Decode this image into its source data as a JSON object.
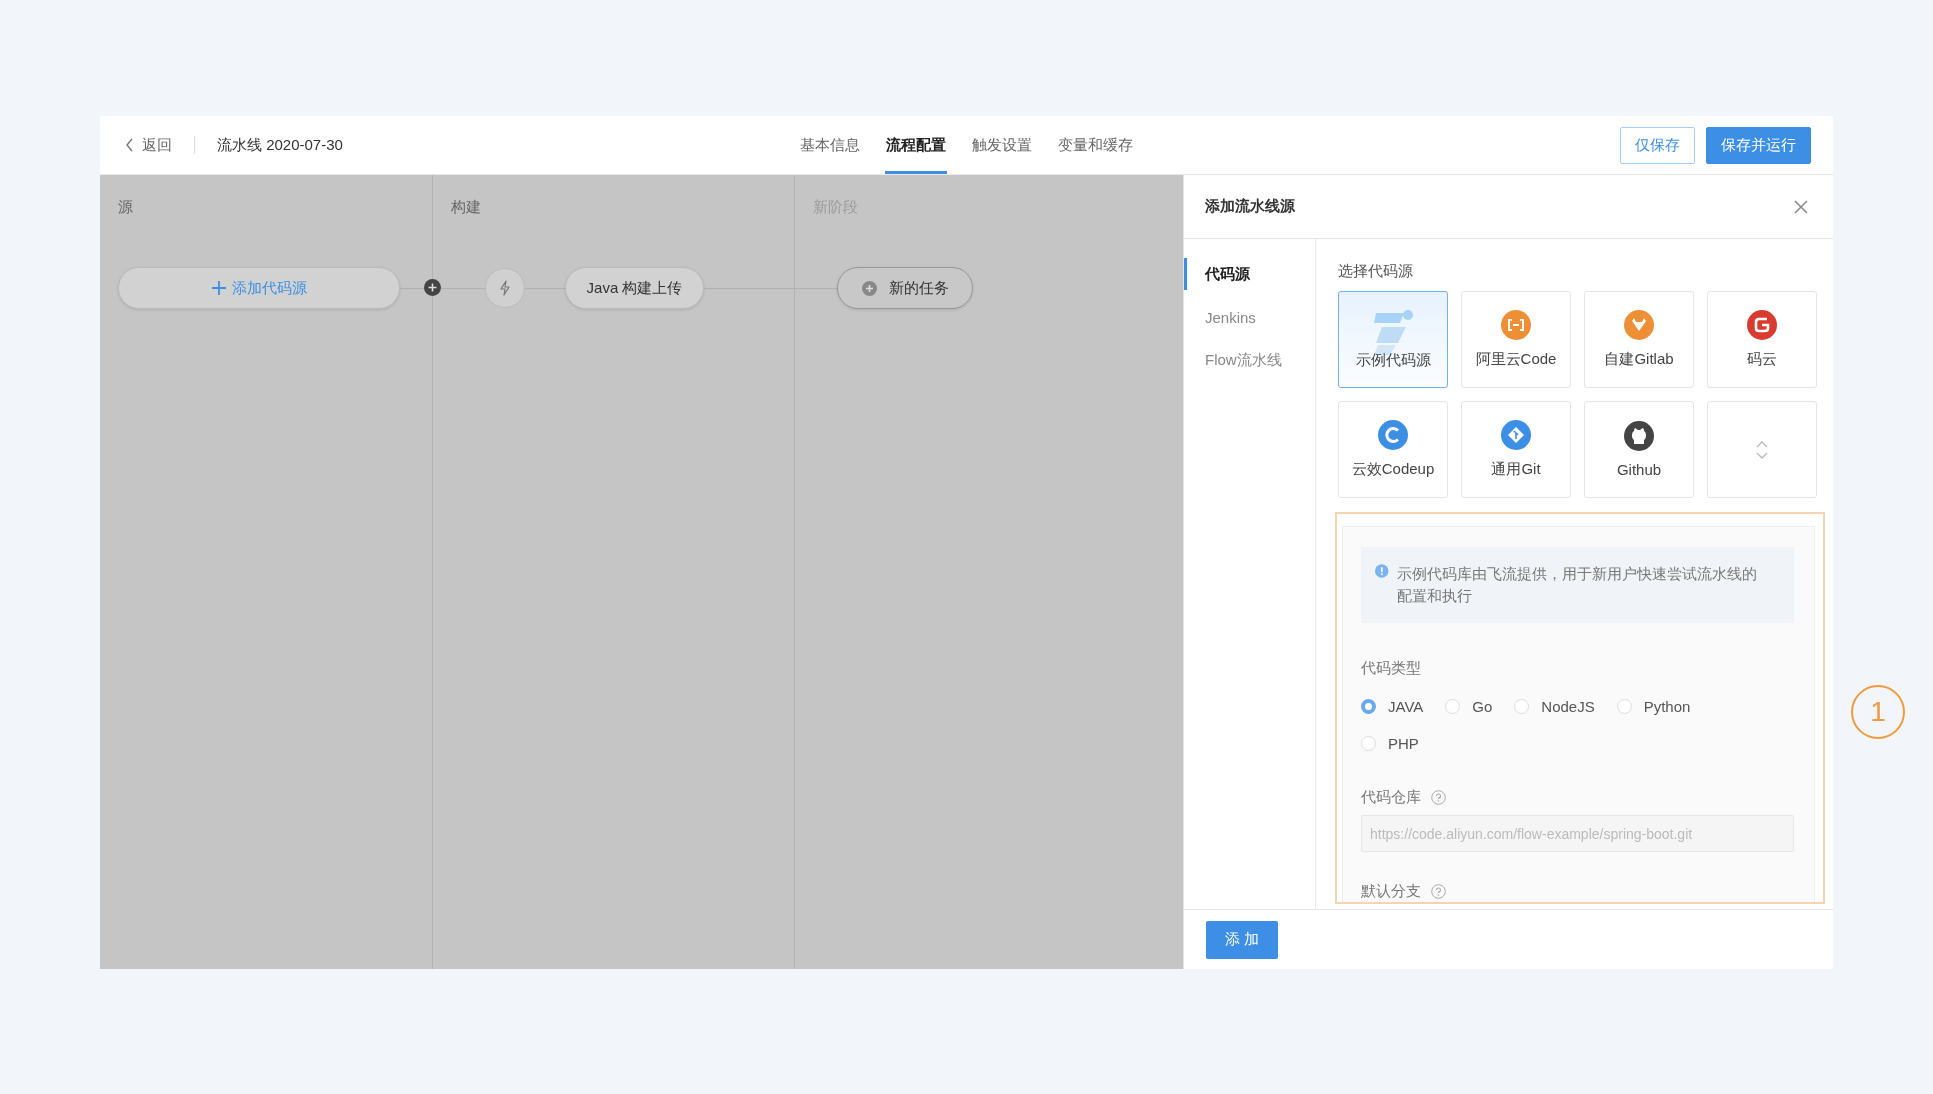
{
  "header": {
    "back": "返回",
    "title": "流水线 2020-07-30",
    "tabs": [
      {
        "label": "基本信息",
        "selected": false
      },
      {
        "label": "流程配置",
        "selected": true
      },
      {
        "label": "触发设置",
        "selected": false
      },
      {
        "label": "变量和缓存",
        "selected": false
      }
    ],
    "buttons": [
      {
        "label": "仅保存",
        "kind": "secondary"
      },
      {
        "label": "保存并运行",
        "kind": "primary"
      }
    ]
  },
  "stages": [
    {
      "title": "源",
      "disabled": false
    },
    {
      "title": "构建",
      "disabled": false
    },
    {
      "title": "新阶段",
      "disabled": true
    }
  ],
  "nodes": {
    "add_source": "添加代码源",
    "build_job": "Java 构建上传",
    "new_task": "新的任务"
  },
  "panel": {
    "title": "添加流水线源",
    "nav": [
      {
        "label": "代码源",
        "selected": true
      },
      {
        "label": "Jenkins",
        "selected": false
      },
      {
        "label": "Flow流水线",
        "selected": false
      }
    ],
    "section_label": "选择代码源",
    "sources": [
      {
        "label": "示例代码源",
        "kind": "example",
        "selected": true
      },
      {
        "label": "阿里云Code",
        "kind": "aliyun",
        "selected": false
      },
      {
        "label": "自建Gitlab",
        "kind": "gitlab",
        "selected": false
      },
      {
        "label": "码云",
        "kind": "gitee",
        "selected": false
      },
      {
        "label": "云效Codeup",
        "kind": "codeup",
        "selected": false
      },
      {
        "label": "通用Git",
        "kind": "git",
        "selected": false
      },
      {
        "label": "Github",
        "kind": "github",
        "selected": false
      },
      {
        "kind": "expand",
        "selected": false
      }
    ],
    "info": "示例代码库由飞流提供，用于新用户快速尝试流水线的配置和执行",
    "code_type": {
      "label": "代码类型",
      "options": [
        {
          "label": "JAVA",
          "selected": true
        },
        {
          "label": "Go",
          "selected": false
        },
        {
          "label": "NodeJS",
          "selected": false
        },
        {
          "label": "Python",
          "selected": false
        },
        {
          "label": "PHP",
          "selected": false
        }
      ]
    },
    "repo": {
      "label": "代码仓库",
      "value": "https://code.aliyun.com/flow-example/spring-boot.git",
      "disabled": true
    },
    "branch": {
      "label": "默认分支"
    },
    "submit": "添 加"
  },
  "annotation": {
    "number": "1"
  }
}
